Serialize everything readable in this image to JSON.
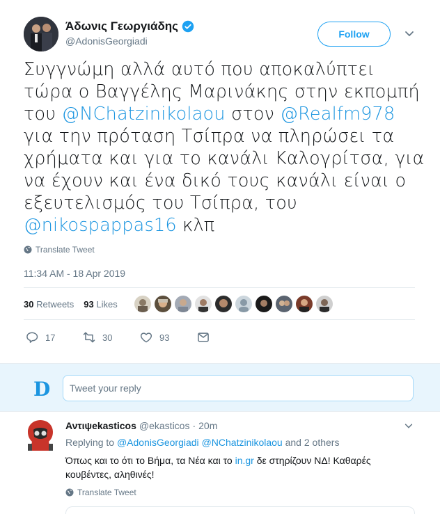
{
  "author": {
    "name": "Άδωνις Γεωργιάδης",
    "handle": "@AdonisGeorgiadi",
    "follow_label": "Follow"
  },
  "tweet": {
    "segments": [
      {
        "text": "Συγγνώμη αλλά αυτό που αποκαλύπτει τώρα ο Βαγγέλης Μαρινάκης στην εκπομπή του ",
        "link": false
      },
      {
        "text": "@NChatzinikolaou",
        "link": true
      },
      {
        "text": " στον ",
        "link": false
      },
      {
        "text": "@Realfm978",
        "link": true
      },
      {
        "text": " για την πρόταση Τσίπρα να πληρώσει τα χρήματα και για το κανάλι Καλογρίτσα, για να έχουν και ένα δικό τους κανάλι είναι ο εξευτελισμός του Τσίπρα, του ",
        "link": false
      },
      {
        "text": "@nikospappas16",
        "link": true
      },
      {
        "text": " κλπ",
        "link": false
      }
    ],
    "translate_label": "Translate Tweet",
    "timestamp": "11:34 AM - 18 Apr 2019",
    "retweets_count": "30",
    "retweets_label": "Retweets",
    "likes_count": "93",
    "likes_label": "Likes",
    "liker_avatar_count": 10
  },
  "actions": {
    "reply_count": "17",
    "retweet_count": "30",
    "like_count": "93",
    "icons": [
      "reply-icon",
      "retweet-icon",
      "like-icon",
      "message-icon"
    ]
  },
  "reply_box": {
    "logo_letter": "D",
    "placeholder": "Tweet your reply"
  },
  "reply": {
    "name": "Αντιψekasticos",
    "handle": "@ekasticos",
    "separator": "·",
    "time": "20m",
    "replying_prefix": "Replying to",
    "replying_user1": "@AdonisGeorgiadi",
    "replying_user2": "@NChatzinikolaou",
    "replying_suffix": "and 2 others",
    "text_before_link": "Όπως και το ότι το Βήμα, τα Νέα και το ",
    "text_link": "in.gr",
    "text_after_link": " δε στηρίζουν ΝΔ! Καθαρές κουβέντες, αληθινές!",
    "translate_label": "Translate Tweet"
  },
  "colors": {
    "link": "#1b95e0",
    "accent": "#1da1f2",
    "muted": "#657786",
    "reply_bg": "#e8f5fd"
  }
}
